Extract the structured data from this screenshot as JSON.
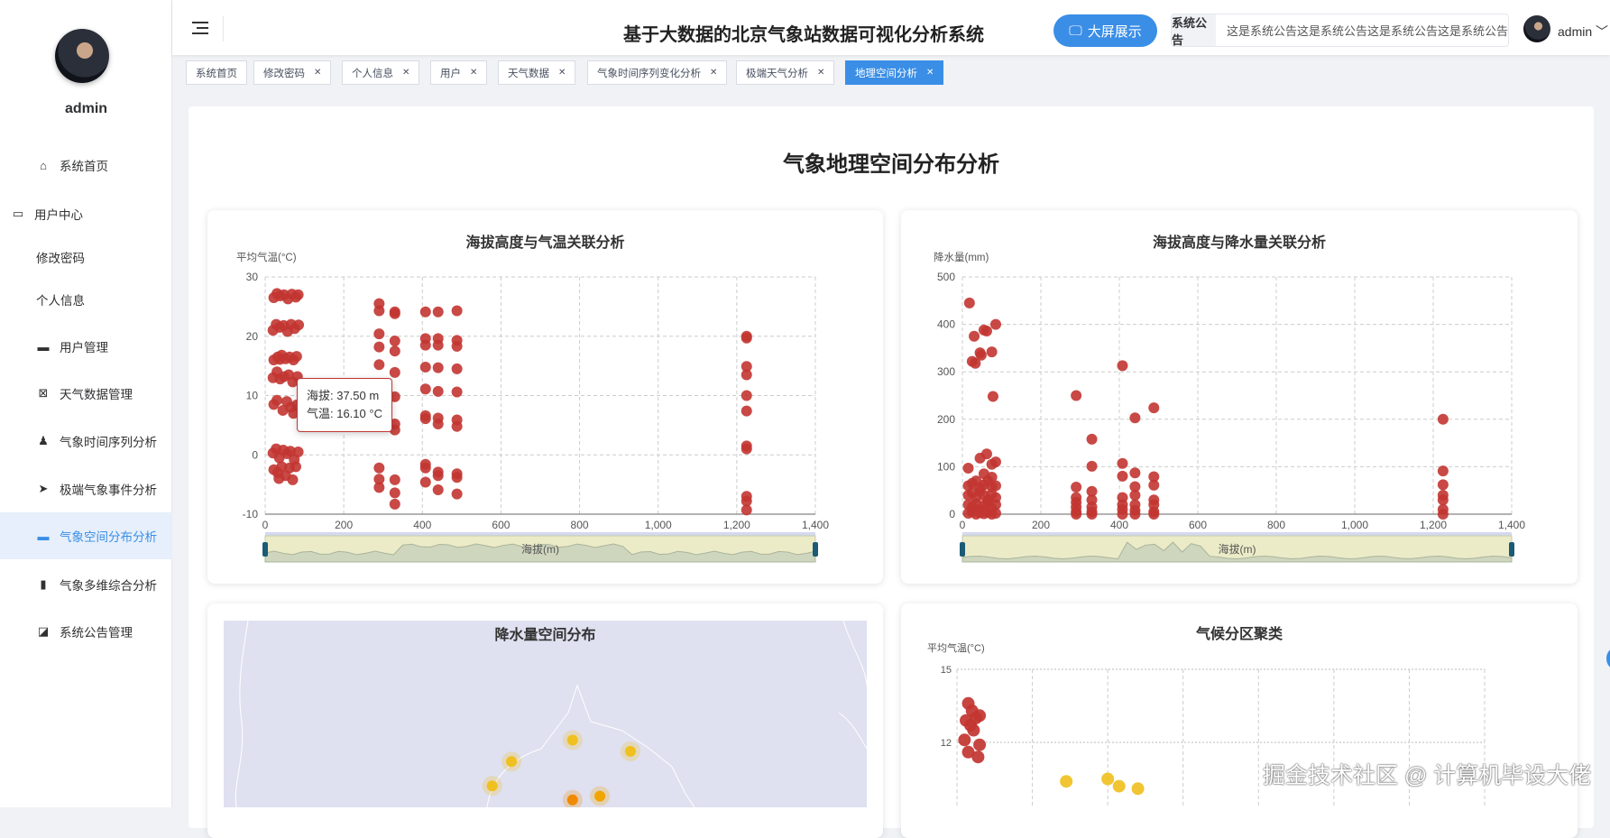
{
  "sidebar": {
    "username": "admin",
    "items": [
      {
        "label": "系统首页",
        "icon": "home-icon"
      },
      {
        "label": "用户中心",
        "icon": "wallet-icon"
      },
      {
        "label": "修改密码"
      },
      {
        "label": "个人信息"
      },
      {
        "label": "用户管理",
        "icon": "ticket-icon"
      },
      {
        "label": "天气数据管理",
        "icon": "clipboard-x-icon"
      },
      {
        "label": "气象时间序列分析",
        "icon": "stamp-icon"
      },
      {
        "label": "极端气象事件分析",
        "icon": "send-icon"
      },
      {
        "label": "气象空间分布分析",
        "icon": "chat-icon",
        "active": true
      },
      {
        "label": "气象多维综合分析",
        "icon": "bar-chart-icon"
      },
      {
        "label": "系统公告管理",
        "icon": "trend-icon"
      }
    ]
  },
  "header": {
    "title": "基于大数据的北京气象站数据可视化分析系统",
    "big_screen": "大屏展示",
    "notice_label": "系统公告",
    "notice_text": "这是系统公告这是系统公告这是系统公告这是系统公告",
    "user": "admin"
  },
  "tabs": [
    {
      "label": "系统首页",
      "closable": false
    },
    {
      "label": "修改密码",
      "closable": true
    },
    {
      "label": "个人信息",
      "closable": true
    },
    {
      "label": "用户",
      "closable": true
    },
    {
      "label": "天气数据",
      "closable": true
    },
    {
      "label": "气象时间序列变化分析",
      "closable": true
    },
    {
      "label": "极端天气分析",
      "closable": true
    },
    {
      "label": "地理空间分析",
      "closable": true,
      "active": true
    }
  ],
  "close_glyph": "✕",
  "page_title": "气象地理空间分布分析",
  "tooltip": {
    "line1": "海拔: 37.50 m",
    "line2": "气温: 16.10 °C"
  },
  "watermark": "掘金技术社区 @ 计算机毕设大佬",
  "colors": {
    "accent": "#3a8ee6",
    "point": "#c23531",
    "yellow": "#f0c020",
    "orange": "#f08a00"
  },
  "chart_data": [
    {
      "type": "scatter",
      "title": "海拔高度与气温关联分析",
      "xlabel": "海拔(m)",
      "ylabel": "平均气温(°C)",
      "xlim": [
        0,
        1400
      ],
      "ylim": [
        -10,
        30
      ],
      "xticks": [
        "0",
        "200",
        "400",
        "600",
        "800",
        "1,000",
        "1,200",
        "1,400"
      ],
      "yticks": [
        "-10",
        "0",
        "10",
        "20",
        "30"
      ],
      "points": [
        [
          22,
          26.5
        ],
        [
          30,
          27.2
        ],
        [
          38,
          26.8
        ],
        [
          48,
          27
        ],
        [
          58,
          26.3
        ],
        [
          68,
          27.1
        ],
        [
          78,
          26.6
        ],
        [
          84,
          27
        ],
        [
          20,
          21
        ],
        [
          28,
          22
        ],
        [
          37,
          21.5
        ],
        [
          47,
          21.8
        ],
        [
          57,
          20.8
        ],
        [
          66,
          22
        ],
        [
          75,
          21.3
        ],
        [
          85,
          21.9
        ],
        [
          22,
          16
        ],
        [
          32,
          16.5
        ],
        [
          42,
          16.8
        ],
        [
          52,
          16.2
        ],
        [
          62,
          16.5
        ],
        [
          72,
          16
        ],
        [
          80,
          16.6
        ],
        [
          20,
          13
        ],
        [
          30,
          14
        ],
        [
          38,
          12.8
        ],
        [
          48,
          13.2
        ],
        [
          60,
          13.5
        ],
        [
          70,
          12.3
        ],
        [
          82,
          13.2
        ],
        [
          22,
          8.5
        ],
        [
          30,
          9.2
        ],
        [
          37.5,
          16.1
        ],
        [
          45,
          7.5
        ],
        [
          55,
          9
        ],
        [
          65,
          8
        ],
        [
          72,
          7
        ],
        [
          80,
          8.4
        ],
        [
          20,
          0.3
        ],
        [
          28,
          1
        ],
        [
          36,
          -0.5
        ],
        [
          46,
          0.8
        ],
        [
          56,
          0.2
        ],
        [
          64,
          0.6
        ],
        [
          74,
          -0.8
        ],
        [
          84,
          0.5
        ],
        [
          22,
          -2.5
        ],
        [
          32,
          -3
        ],
        [
          42,
          -2
        ],
        [
          52,
          -3.5
        ],
        [
          62,
          -2.2
        ],
        [
          70,
          -4.2
        ],
        [
          78,
          -2
        ],
        [
          35,
          -4
        ],
        [
          290,
          25.5
        ],
        [
          290,
          24.3
        ],
        [
          290,
          20.4
        ],
        [
          290,
          18.2
        ],
        [
          290,
          15.2
        ],
        [
          290,
          -2.2
        ],
        [
          290,
          -4.1
        ],
        [
          290,
          -5.5
        ],
        [
          330,
          24.1
        ],
        [
          330,
          23.8
        ],
        [
          330,
          19.2
        ],
        [
          330,
          17.5
        ],
        [
          330,
          13.9
        ],
        [
          330,
          9.8
        ],
        [
          330,
          5.2
        ],
        [
          330,
          4.2
        ],
        [
          330,
          -4.2
        ],
        [
          330,
          -6.4
        ],
        [
          330,
          -8.3
        ],
        [
          408,
          24.1
        ],
        [
          408,
          19.6
        ],
        [
          408,
          18.5
        ],
        [
          408,
          14.8
        ],
        [
          408,
          11.1
        ],
        [
          408,
          6.6
        ],
        [
          408,
          6.1
        ],
        [
          408,
          -1.6
        ],
        [
          408,
          -2.2
        ],
        [
          408,
          -4.6
        ],
        [
          440,
          24.1
        ],
        [
          440,
          19.6
        ],
        [
          440,
          18.5
        ],
        [
          440,
          14.7
        ],
        [
          440,
          10.7
        ],
        [
          440,
          6.2
        ],
        [
          440,
          5.2
        ],
        [
          440,
          -2.9
        ],
        [
          440,
          -3.5
        ],
        [
          440,
          -5.9
        ],
        [
          488,
          24.3
        ],
        [
          488,
          19.3
        ],
        [
          488,
          18.3
        ],
        [
          488,
          14.5
        ],
        [
          488,
          10.6
        ],
        [
          488,
          5.9
        ],
        [
          488,
          4.8
        ],
        [
          488,
          -3.2
        ],
        [
          488,
          -3.8
        ],
        [
          488,
          -6.6
        ],
        [
          1225,
          20
        ],
        [
          1225,
          19.7
        ],
        [
          1225,
          14.9
        ],
        [
          1225,
          13.5
        ],
        [
          1225,
          10
        ],
        [
          1225,
          7.4
        ],
        [
          1225,
          1.5
        ],
        [
          1225,
          1
        ],
        [
          1225,
          -7
        ],
        [
          1225,
          -7.8
        ],
        [
          1225,
          -9.3
        ]
      ]
    },
    {
      "type": "scatter",
      "title": "海拔高度与降水量关联分析",
      "xlabel": "海拔(m)",
      "ylabel": "降水量(mm)",
      "xlim": [
        0,
        1400
      ],
      "ylim": [
        0,
        500
      ],
      "xticks": [
        "0",
        "200",
        "400",
        "600",
        "800",
        "1,000",
        "1,200",
        "1,400"
      ],
      "yticks": [
        "0",
        "100",
        "200",
        "300",
        "400",
        "500"
      ],
      "points": [
        [
          18,
          445
        ],
        [
          30,
          375
        ],
        [
          25,
          322
        ],
        [
          33,
          318
        ],
        [
          45,
          340
        ],
        [
          48,
          335
        ],
        [
          55,
          388
        ],
        [
          62,
          386
        ],
        [
          75,
          342
        ],
        [
          78,
          248
        ],
        [
          85,
          400
        ],
        [
          15,
          97
        ],
        [
          45,
          118
        ],
        [
          62,
          127
        ],
        [
          85,
          110
        ],
        [
          75,
          105
        ],
        [
          55,
          85
        ],
        [
          75,
          78
        ],
        [
          15,
          60
        ],
        [
          25,
          65
        ],
        [
          35,
          70
        ],
        [
          45,
          55
        ],
        [
          55,
          62
        ],
        [
          65,
          70
        ],
        [
          75,
          58
        ],
        [
          85,
          60
        ],
        [
          15,
          40
        ],
        [
          25,
          45
        ],
        [
          35,
          35
        ],
        [
          45,
          48
        ],
        [
          55,
          40
        ],
        [
          65,
          30
        ],
        [
          75,
          42
        ],
        [
          85,
          35
        ],
        [
          15,
          20
        ],
        [
          25,
          15
        ],
        [
          35,
          22
        ],
        [
          45,
          10
        ],
        [
          55,
          18
        ],
        [
          65,
          25
        ],
        [
          75,
          12
        ],
        [
          85,
          20
        ],
        [
          15,
          2
        ],
        [
          25,
          5
        ],
        [
          35,
          0
        ],
        [
          45,
          3
        ],
        [
          55,
          1
        ],
        [
          65,
          4
        ],
        [
          75,
          0
        ],
        [
          85,
          2
        ],
        [
          290,
          250
        ],
        [
          290,
          57
        ],
        [
          290,
          35
        ],
        [
          290,
          25
        ],
        [
          290,
          15
        ],
        [
          290,
          5
        ],
        [
          290,
          0
        ],
        [
          330,
          158
        ],
        [
          330,
          101
        ],
        [
          330,
          48
        ],
        [
          330,
          30
        ],
        [
          330,
          15
        ],
        [
          330,
          5
        ],
        [
          330,
          0
        ],
        [
          408,
          313
        ],
        [
          408,
          107
        ],
        [
          408,
          80
        ],
        [
          408,
          35
        ],
        [
          408,
          20
        ],
        [
          408,
          10
        ],
        [
          408,
          0
        ],
        [
          440,
          203
        ],
        [
          440,
          87
        ],
        [
          440,
          58
        ],
        [
          440,
          40
        ],
        [
          440,
          20
        ],
        [
          440,
          8
        ],
        [
          440,
          0
        ],
        [
          488,
          224
        ],
        [
          488,
          79
        ],
        [
          488,
          61
        ],
        [
          488,
          30
        ],
        [
          488,
          20
        ],
        [
          488,
          5
        ],
        [
          488,
          0
        ],
        [
          1225,
          200
        ],
        [
          1225,
          91
        ],
        [
          1225,
          62
        ],
        [
          1225,
          40
        ],
        [
          1225,
          30
        ],
        [
          1225,
          10
        ],
        [
          1225,
          0
        ]
      ]
    },
    {
      "type": "map-scatter",
      "title": "降水量空间分布",
      "points": [
        {
          "lon": 116.67,
          "lat": 40.72,
          "level": "low"
        },
        {
          "lon": 116.29,
          "lat": 40.49,
          "level": "low"
        },
        {
          "lon": 117.03,
          "lat": 40.6,
          "level": "low"
        },
        {
          "lon": 116.17,
          "lat": 40.23,
          "level": "low"
        },
        {
          "lon": 116.67,
          "lat": 40.08,
          "level": "high"
        },
        {
          "lon": 116.84,
          "lat": 40.12,
          "level": "mid"
        }
      ]
    },
    {
      "type": "scatter",
      "title": "气候分区聚类",
      "ylabel": "平均气温(°C)",
      "ylim_top": 15,
      "yticks": [
        "15",
        "12"
      ],
      "clusters": [
        {
          "color": "#c23531",
          "points": [
            [
              0.15,
              13.6
            ],
            [
              0.2,
              13.3
            ],
            [
              0.25,
              13
            ],
            [
              0.3,
              13.1
            ],
            [
              0.12,
              12.9
            ],
            [
              0.18,
              12.7
            ],
            [
              0.1,
              12.1
            ],
            [
              0.3,
              11.9
            ],
            [
              0.15,
              11.6
            ],
            [
              0.28,
              11.4
            ],
            [
              0.22,
              12.5
            ]
          ]
        },
        {
          "color": "#f0c020",
          "points": [
            [
              1.45,
              10.4
            ],
            [
              2.0,
              10.5
            ],
            [
              2.15,
              10.2
            ],
            [
              2.4,
              10.1
            ]
          ]
        }
      ]
    }
  ]
}
